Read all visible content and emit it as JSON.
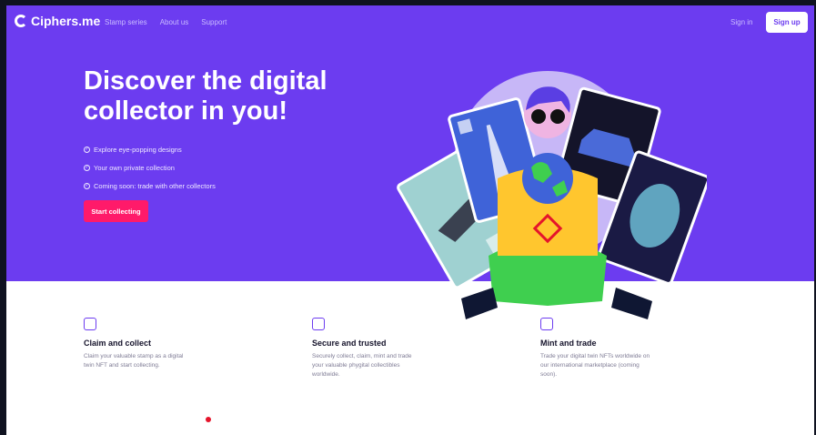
{
  "brand": {
    "name": "Ciphers.me",
    "color": "#6c3cf0",
    "accent": "#ff1a6a"
  },
  "nav": {
    "links": [
      "Stamp series",
      "About us",
      "Support"
    ],
    "signin": "Sign in",
    "signup": "Sign up"
  },
  "hero": {
    "headline_line1": "Discover the digital",
    "headline_line2": "collector in you!",
    "bullets": [
      "Explore eye-popping designs",
      "Your own private collection",
      "Coming soon: trade with other collectors"
    ],
    "cta": "Start collecting"
  },
  "features": [
    {
      "icon": "stamp-icon",
      "title": "Claim and collect",
      "desc": "Claim your valuable stamp as a digital twin NFT and start collecting."
    },
    {
      "icon": "hand-pointer-icon",
      "title": "Secure and trusted",
      "desc": "Securely collect, claim, mint and trade your valuable phygital collectibles worldwide."
    },
    {
      "icon": "trade-icon",
      "title": "Mint and trade",
      "desc": "Trade your digital twin NFTs worldwide on our international marketplace (coming soon)."
    }
  ]
}
